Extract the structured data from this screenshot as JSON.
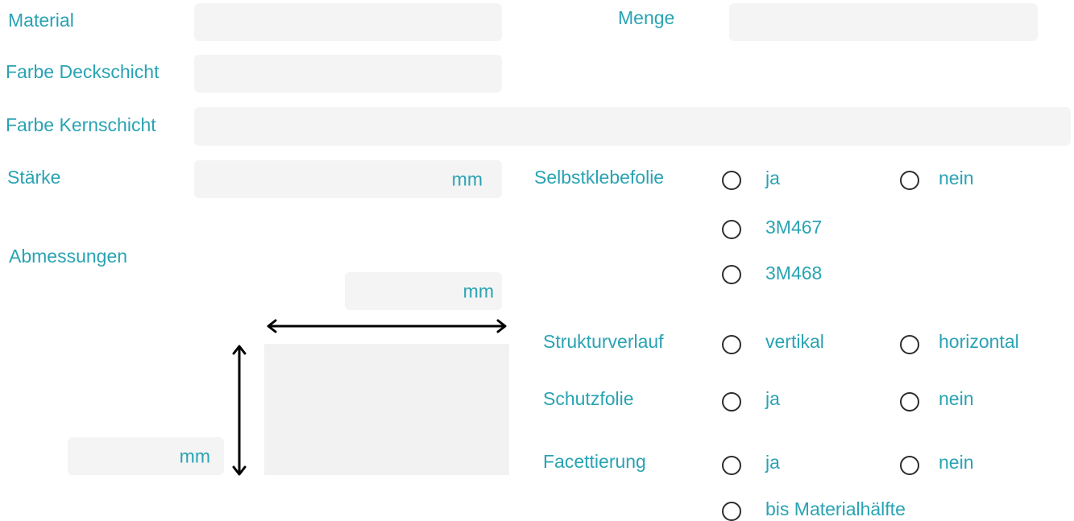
{
  "form": {
    "material": {
      "label": "Material",
      "value": ""
    },
    "menge": {
      "label": "Menge",
      "value": ""
    },
    "farbe_deckschicht": {
      "label": "Farbe Deckschicht",
      "value": ""
    },
    "farbe_kernschicht": {
      "label": "Farbe Kernschicht",
      "value": ""
    },
    "staerke": {
      "label": "Stärke",
      "value": "",
      "unit": "mm"
    },
    "abmessungen": {
      "label": "Abmessungen",
      "width_unit": "mm",
      "height_unit": "mm"
    },
    "selbstklebefolie": {
      "label": "Selbstklebefolie",
      "options": [
        "ja",
        "nein",
        "3M467",
        "3M468"
      ],
      "selected": null
    },
    "strukturverlauf": {
      "label": "Strukturverlauf",
      "options": [
        "vertikal",
        "horizontal"
      ],
      "selected": null
    },
    "schutzfolie": {
      "label": "Schutzfolie",
      "options": [
        "ja",
        "nein"
      ],
      "selected": null
    },
    "facettierung": {
      "label": "Facettierung",
      "options": [
        "ja",
        "nein",
        "bis Materialhälfte"
      ],
      "selected": null
    }
  },
  "colors": {
    "label_text": "#29a3b3",
    "field_background": "#f4f4f4",
    "radio_border": "#2c2c2c",
    "arrow": "#000000"
  },
  "icons": {
    "width_arrow": "double-arrow-horizontal-icon",
    "height_arrow": "double-arrow-vertical-icon",
    "radio": "radio-circle-icon"
  }
}
